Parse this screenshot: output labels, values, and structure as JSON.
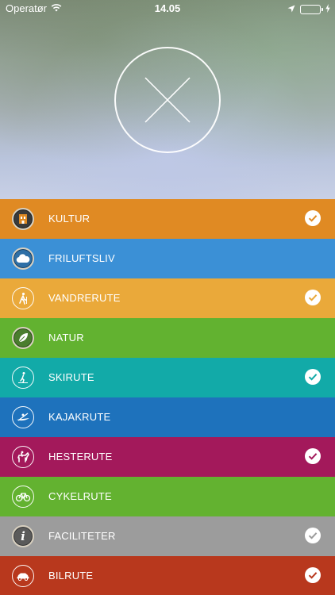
{
  "status_bar": {
    "carrier": "Operatør",
    "time": "14.05"
  },
  "header": {
    "close_icon": "close-x-icon"
  },
  "categories": [
    {
      "label": "KULTUR",
      "color": "#e08a23",
      "icon": "culture-icon",
      "checked": true
    },
    {
      "label": "FRILUFTSLIV",
      "color": "#3b90d6",
      "icon": "cloud-icon",
      "checked": false
    },
    {
      "label": "VANDRERUTE",
      "color": "#eaa93a",
      "icon": "hiker-icon",
      "checked": true
    },
    {
      "label": "NATUR",
      "color": "#62b230",
      "icon": "leaf-icon",
      "checked": false
    },
    {
      "label": "SKIRUTE",
      "color": "#12aaa8",
      "icon": "skier-icon",
      "checked": true
    },
    {
      "label": "KAJAKRUTE",
      "color": "#1e72bc",
      "icon": "kayak-icon",
      "checked": false
    },
    {
      "label": "HESTERUTE",
      "color": "#a3195b",
      "icon": "horse-icon",
      "checked": true
    },
    {
      "label": "CYKELRUTE",
      "color": "#63b230",
      "icon": "bicycle-icon",
      "checked": false
    },
    {
      "label": "FACILITETER",
      "color": "#9c9c9c",
      "icon": "info-icon",
      "checked": true
    },
    {
      "label": "BILRUTE",
      "color": "#b8381d",
      "icon": "car-icon",
      "checked": true
    }
  ]
}
